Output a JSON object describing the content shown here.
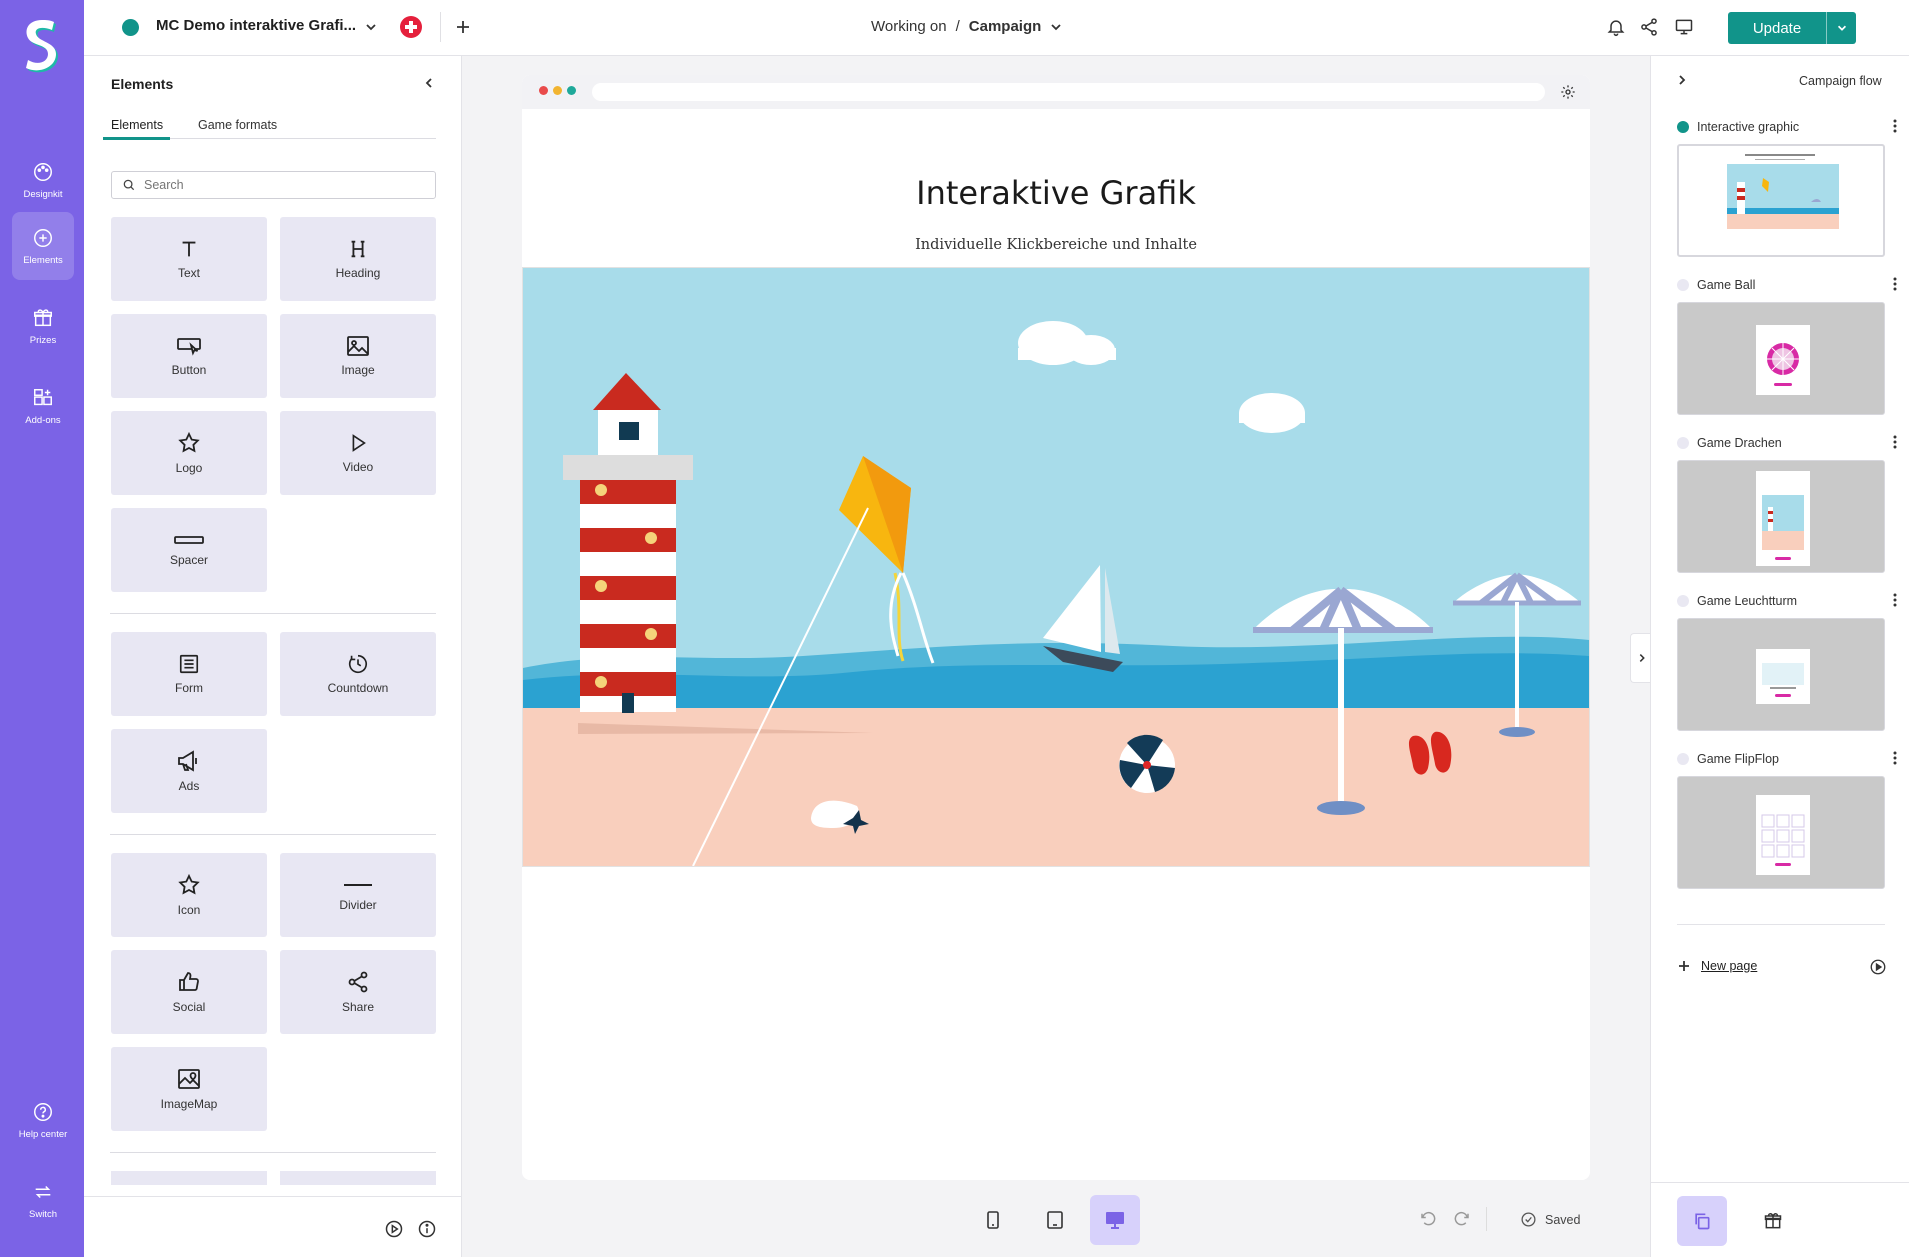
{
  "colors": {
    "rail": "#7b63e6",
    "accent": "#11948a",
    "tile": "#e8e7f3",
    "danger": "#e5203c"
  },
  "rail": {
    "items": [
      {
        "label": "Designkit",
        "icon": "palette-icon"
      },
      {
        "label": "Elements",
        "icon": "plus-circle-icon"
      },
      {
        "label": "Prizes",
        "icon": "gift-icon"
      },
      {
        "label": "Add-ons",
        "icon": "addons-icon"
      }
    ],
    "help": "Help center",
    "switch": "Switch"
  },
  "topbar": {
    "project_title": "MC Demo interaktive Grafi...",
    "working_on": "Working on",
    "separator": "/",
    "context": "Campaign",
    "update_label": "Update"
  },
  "panel": {
    "title": "Elements",
    "tabs": [
      "Elements",
      "Game formats"
    ],
    "search_placeholder": "Search",
    "group1": [
      "Text",
      "Heading",
      "Button",
      "Image",
      "Logo",
      "Video",
      "Spacer"
    ],
    "group2": [
      "Form",
      "Countdown",
      "Ads"
    ],
    "group3": [
      "Icon",
      "Divider",
      "Social",
      "Share",
      "ImageMap"
    ]
  },
  "canvas": {
    "title": "Interaktive Grafik",
    "subtitle": "Individuelle Klickbereiche und Inhalte"
  },
  "rpanel": {
    "title": "Campaign flow",
    "pages": [
      "Interactive graphic",
      "Game Ball",
      "Game Drachen",
      "Game Leuchtturm",
      "Game FlipFlop"
    ],
    "new_page": "New page"
  },
  "bottom": {
    "saved": "Saved"
  }
}
